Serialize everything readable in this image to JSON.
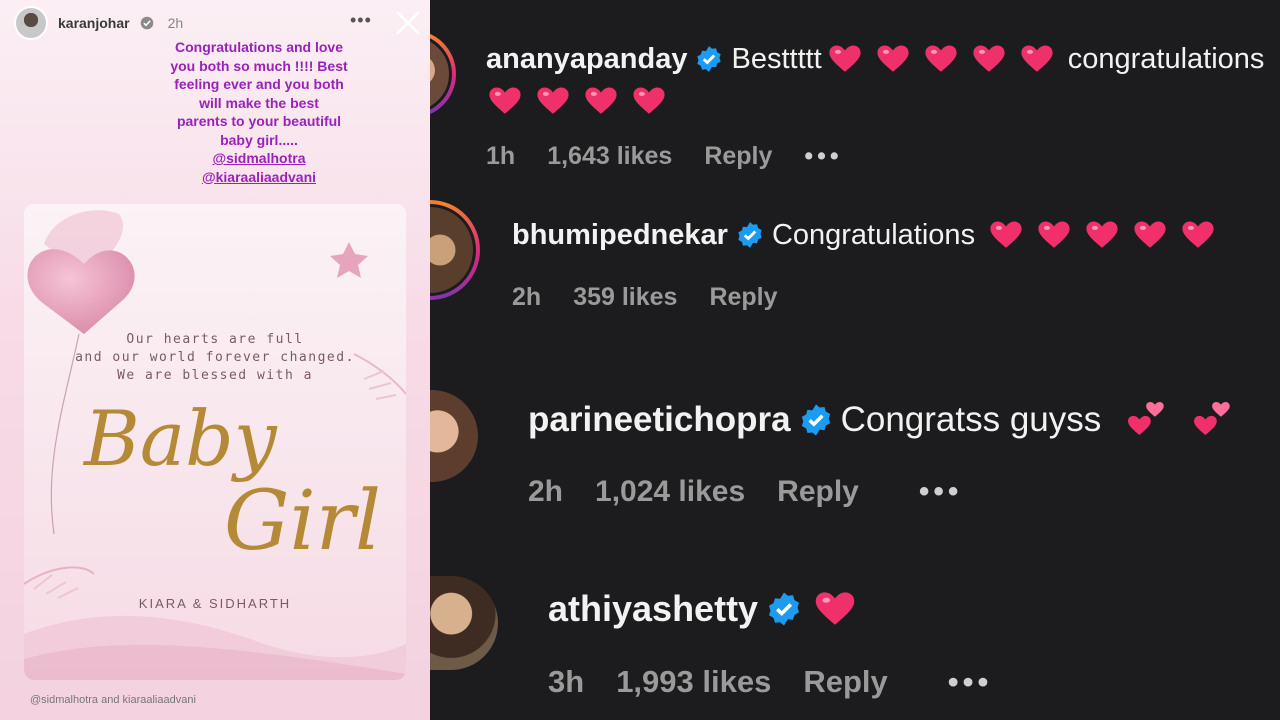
{
  "story": {
    "username": "karanjohar",
    "time": "2h",
    "more_icon": "more-horizontal-icon",
    "close_icon": "close-icon",
    "caption_lines": [
      "Congratulations and love",
      "you both so much !!!! Best",
      "feeling ever and you both",
      "will make the best",
      "parents to your beautiful",
      "baby girl....."
    ],
    "mentions": [
      "@sidmalhotra",
      "@kiaraaliaadvani"
    ],
    "card": {
      "line1": "Our hearts are full",
      "line2": "and our world forever changed.",
      "line3": "We are blessed with a",
      "script1": "Baby",
      "script2": "Girl",
      "names": "KIARA & SIDHARTH"
    },
    "footer_mention1": "@sidmalhotra",
    "footer_and": "and",
    "footer_mention2": "kiaraaliaadvani",
    "caption_color": "#9b22b8"
  },
  "comments": [
    {
      "username": "ananyapanday",
      "text": "Besttttt",
      "after": "congratulations",
      "hearts_inline": 5,
      "hearts_second_line": 4,
      "time": "1h",
      "likes": "1,643 likes",
      "reply": "Reply",
      "has_more": true
    },
    {
      "username": "bhumipednekar",
      "text": "Congratulations",
      "hearts_inline": 5,
      "time": "2h",
      "likes": "359 likes",
      "reply": "Reply",
      "has_more": false
    },
    {
      "username": "parineetichopra",
      "text": "Congratss guyss",
      "hearts_inline": 2,
      "heart_style": "two-hearts",
      "time": "2h",
      "likes": "1,024 likes",
      "reply": "Reply",
      "has_more": true
    },
    {
      "username": "athiyashetty",
      "text": "",
      "hearts_inline": 1,
      "time": "3h",
      "likes": "1,993 likes",
      "reply": "Reply",
      "has_more": true
    }
  ],
  "colors": {
    "verified": "#1d9bf0",
    "heart": "#f0306b",
    "background": "#1c1c1e",
    "meta_text": "#9a9a9a"
  }
}
